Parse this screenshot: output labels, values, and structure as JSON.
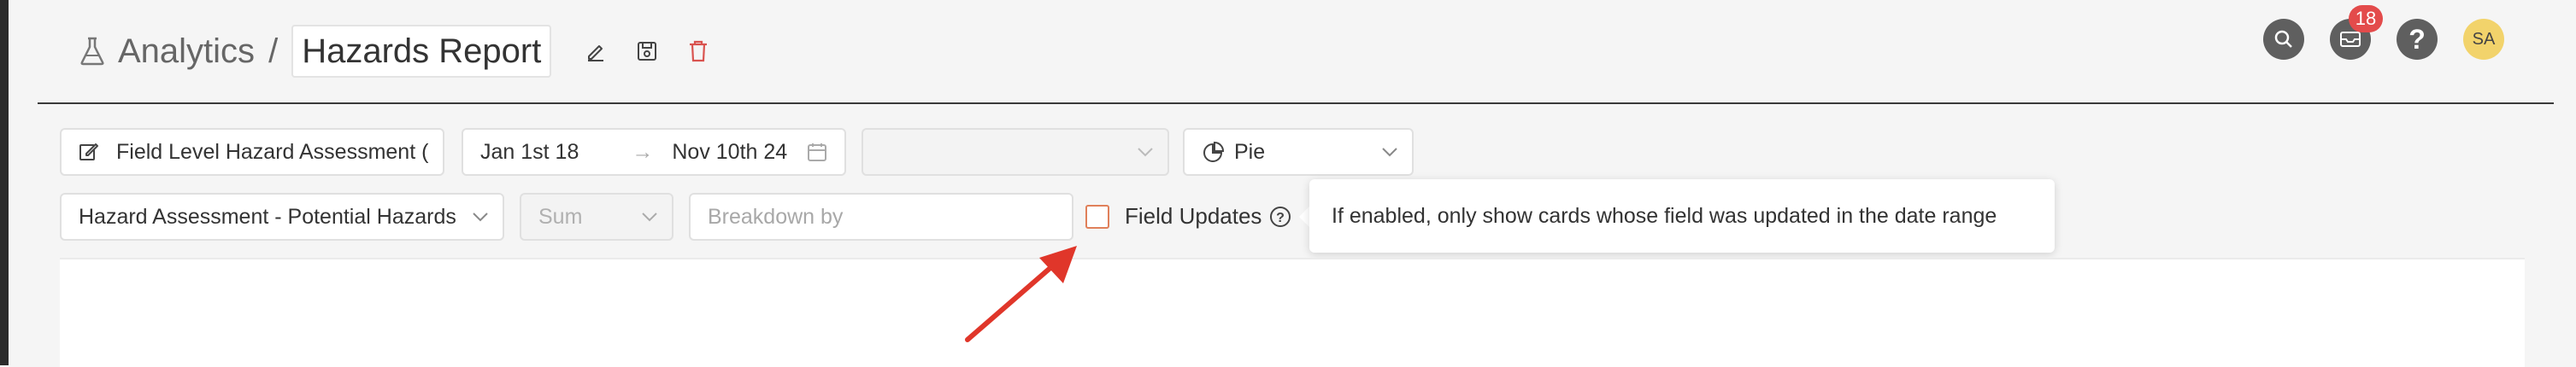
{
  "header": {
    "breadcrumb_root": "Analytics",
    "separator": "/",
    "report_title": "Hazards Report"
  },
  "notifications": {
    "count": "18"
  },
  "user": {
    "initials": "SA"
  },
  "filters": {
    "form": "Field Level Hazard Assessment (",
    "date_start": "Jan 1st 18",
    "date_arrow": "→",
    "date_end": "Nov 10th 24",
    "empty_select": "",
    "chart_type": "Pie",
    "field": "Hazard Assessment - Potential Hazards",
    "aggregation": "Sum",
    "breakdown_placeholder": "Breakdown by",
    "field_updates_label": "Field Updates",
    "field_updates_checked": false
  },
  "tooltip": {
    "text": "If enabled, only show cards whose field was updated in the date range"
  },
  "colors": {
    "badge": "#e34b4b",
    "avatar": "#f2d36b",
    "delete": "#d9534f",
    "arrow": "#e0362a"
  }
}
